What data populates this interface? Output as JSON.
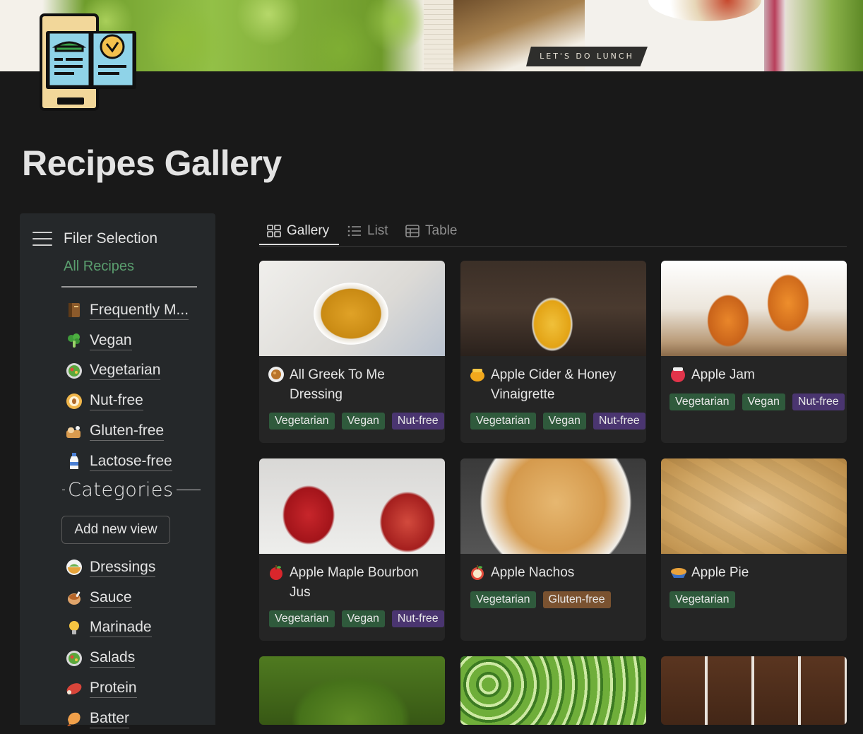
{
  "cover": {
    "banner_text": "LET'S DO LUNCH"
  },
  "page": {
    "title": "Recipes Gallery",
    "icon": "recipe-book-icon"
  },
  "sidebar": {
    "filter_title": "Filer Selection",
    "all_recipes": "All Recipes",
    "filters": [
      {
        "label": "Frequently M...",
        "icon": "notebook-icon"
      },
      {
        "label": "Vegan",
        "icon": "broccoli-icon"
      },
      {
        "label": "Vegetarian",
        "icon": "salad-icon"
      },
      {
        "label": "Nut-free",
        "icon": "no-nut-icon"
      },
      {
        "label": "Gluten-free",
        "icon": "bread-icon"
      },
      {
        "label": "Lactose-free",
        "icon": "milk-bottle-icon"
      }
    ],
    "categories_title": "Categories",
    "add_view_label": "Add new view",
    "categories": [
      {
        "label": "Dressings",
        "icon": "dressing-bowl-icon"
      },
      {
        "label": "Sauce",
        "icon": "sauce-pot-icon"
      },
      {
        "label": "Marinade",
        "icon": "light-bulb-icon"
      },
      {
        "label": "Salads",
        "icon": "salad-icon"
      },
      {
        "label": "Protein",
        "icon": "meat-icon"
      },
      {
        "label": "Batter",
        "icon": "shrimp-icon"
      }
    ]
  },
  "tabs": [
    {
      "label": "Gallery",
      "icon": "gallery-icon",
      "active": true
    },
    {
      "label": "List",
      "icon": "list-icon",
      "active": false
    },
    {
      "label": "Table",
      "icon": "table-icon",
      "active": false
    }
  ],
  "cards": [
    {
      "title_line1": "All Greek To Me",
      "title_line2": "Dressing",
      "icon": "falafel-icon",
      "tags": [
        "Vegetarian",
        "Vegan",
        "Nut-free"
      ]
    },
    {
      "title_line1": "Apple Cider & Honey",
      "title_line2": "Vinaigrette",
      "icon": "honey-pot-icon",
      "tags": [
        "Vegetarian",
        "Vegan",
        "Nut-free"
      ]
    },
    {
      "title_line1": "Apple Jam",
      "title_line2": "",
      "icon": "jam-jar-icon",
      "tags": [
        "Vegetarian",
        "Vegan",
        "Nut-free"
      ]
    },
    {
      "title_line1": "Apple Maple Bourbon",
      "title_line2": "Jus",
      "icon": "apple-icon",
      "tags": [
        "Vegetarian",
        "Vegan",
        "Nut-free"
      ]
    },
    {
      "title_line1": "Apple Nachos",
      "title_line2": "",
      "icon": "apple-slice-icon",
      "tags": [
        "Vegetarian",
        "Gluten-free"
      ]
    },
    {
      "title_line1": "Apple Pie",
      "title_line2": "",
      "icon": "pie-icon",
      "tags": [
        "Vegetarian"
      ]
    }
  ],
  "colors": {
    "tag_green": "#2f5a3c",
    "tag_purple": "#4a3570",
    "tag_orange": "#7a5230",
    "accent_link": "#5a9e6e"
  }
}
